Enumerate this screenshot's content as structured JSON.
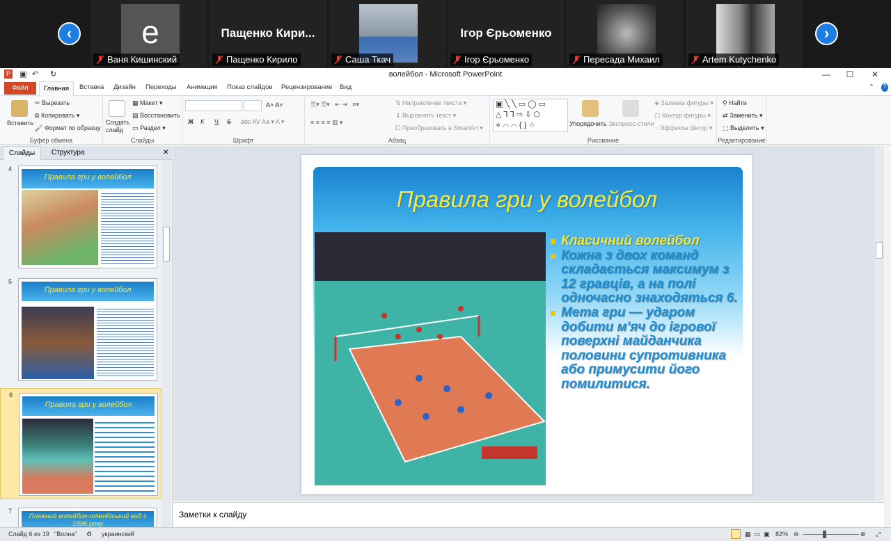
{
  "zoom": {
    "participants": [
      {
        "tile_text": "е",
        "label": "Ваня Кишинский"
      },
      {
        "tile_text": "Пащенко Кири...",
        "label": "Пащенко Кирило"
      },
      {
        "tile_text": "",
        "label": "Саша Ткач"
      },
      {
        "tile_text": "Ігор Єрьоменко",
        "label": "Ігор Єрьоменко"
      },
      {
        "tile_text": "",
        "label": "Пересада Михаил"
      },
      {
        "tile_text": "",
        "label": "Artem Kutychenko"
      }
    ]
  },
  "window": {
    "title": "волейбол - Microsoft PowerPoint"
  },
  "tabs": [
    "Файл",
    "Главная",
    "Вставка",
    "Дизайн",
    "Переходы",
    "Анимация",
    "Показ слайдов",
    "Рецензирование",
    "Вид"
  ],
  "ribbon": {
    "clipboard": {
      "paste": "Вставить",
      "cut": "Вырезать",
      "copy": "Копировать",
      "format": "Формат по образцу",
      "label": "Буфер обмена"
    },
    "slides": {
      "new": "Создать слайд",
      "layout": "Макет",
      "reset": "Восстановить",
      "section": "Раздел",
      "label": "Слайды"
    },
    "font": {
      "label": "Шрифт",
      "buttons": [
        "Ж",
        "К",
        "Ч",
        "S"
      ]
    },
    "paragraph": {
      "direction": "Направление текста",
      "align": "Выровнять текст",
      "smartart": "Преобразовать в SmartArt",
      "label": "Абзац"
    },
    "drawing": {
      "arrange": "Упорядочить",
      "styles": "Экспресс-стили",
      "fill": "Заливка фигуры",
      "outline": "Контур фигуры",
      "effects": "Эффекты фигур",
      "label": "Рисование"
    },
    "editing": {
      "find": "Найти",
      "replace": "Заменить",
      "select": "Выделить",
      "label": "Редактирование"
    }
  },
  "pane": {
    "tab_slides": "Слайды",
    "tab_outline": "Структура",
    "thumbs": [
      {
        "num": "4",
        "title": "Правила гри у волейбол"
      },
      {
        "num": "5",
        "title": "Правила гри у волейбол"
      },
      {
        "num": "6",
        "title": "Правила гри у волейбол"
      },
      {
        "num": "7",
        "title": "Пляжний волейбол-олімпійський вид з 1996 року"
      }
    ]
  },
  "slide": {
    "title": "Правила гри у волейбол",
    "bullets": [
      "Класичний волейбол",
      "Кожна з двох команд складається максимум з 12 гравців, а на полі одночасно знаходяться 6.",
      "Мета гри — ударом добити м'яч до ігрової поверхні майданчика половини супротивника або примусити його помилитися."
    ],
    "colors": {
      "bullet1": "#f6e83a",
      "bullet_rest": "#1d8fd2",
      "title": "#f5ea3c"
    }
  },
  "notes": {
    "placeholder": "Заметки к слайду"
  },
  "status": {
    "slide": "Слайд 6 из 19",
    "theme": "\"Волна\"",
    "lang": "украинский",
    "zoom": "82%"
  }
}
